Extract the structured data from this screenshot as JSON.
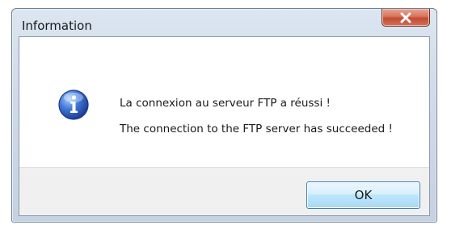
{
  "dialog": {
    "title": "Information",
    "close_icon": "close-icon",
    "info_icon": "information-icon",
    "message_line1": "La connexion au serveur FTP a réussi !",
    "message_line2": "The connection to the FTP server has succeeded !",
    "ok_label": "OK",
    "colors": {
      "close_button": "#c44a31",
      "ok_button": "#bee6fd",
      "info_icon": "#2a5fbf"
    }
  }
}
